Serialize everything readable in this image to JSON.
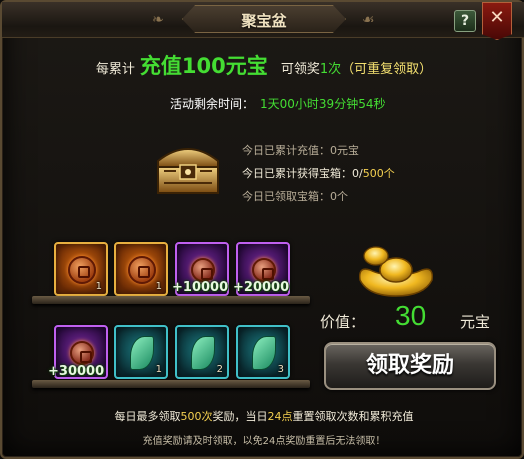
{
  "window": {
    "title": "聚宝盆",
    "help_label": "?",
    "close_label": "✕"
  },
  "headline": {
    "prefix": "每累计",
    "highlight": "充值100元宝",
    "middle": "可领奖",
    "count": "1次",
    "note": "（可重复领取）"
  },
  "timer": {
    "label": "活动剩余时间：",
    "value": "1天00小时39分钟54秒"
  },
  "stats": {
    "recharged_label": "今日已累计充值：",
    "recharged_value": "0元宝",
    "chests_label": "今日已累计获得宝箱：",
    "chests_value": "0/",
    "chests_max": "500个",
    "claimed_label": "今日已领取宝箱：",
    "claimed_value": "0个"
  },
  "rewards": {
    "row1": [
      {
        "type": "gold",
        "icon": "copper-coin-icon",
        "qty": "1"
      },
      {
        "type": "gold",
        "icon": "copper-coin-icon",
        "qty": "1"
      },
      {
        "type": "purple",
        "icon": "copper-coin-icon",
        "qty": ""
      },
      {
        "type": "purple",
        "icon": "copper-coin-icon",
        "qty": ""
      }
    ],
    "row1_amounts": [
      "+10000",
      "+20000"
    ],
    "row2": [
      {
        "type": "purple",
        "icon": "copper-coin-icon",
        "qty": ""
      },
      {
        "type": "teal",
        "icon": "jade-leaf-icon",
        "qty": "1"
      },
      {
        "type": "teal",
        "icon": "jade-leaf-icon",
        "qty": "2"
      },
      {
        "type": "teal",
        "icon": "jade-leaf-icon",
        "qty": "3"
      }
    ],
    "row2_amounts": [
      "+30000"
    ]
  },
  "price": {
    "label": "价值：",
    "value": "30",
    "unit": "元宝"
  },
  "claim_button": "领取奖励",
  "footer": {
    "line1_a": "每日最多领取",
    "line1_b": "500次",
    "line1_c": "奖励，当日",
    "line1_d": "24点",
    "line1_e": "重置领取次数和累积充值",
    "line2": "充值奖励请及时领取，以免24点奖励重置后无法领取！"
  },
  "colors": {
    "accent_green": "#44dd33",
    "highlight_yellow": "#f4d050",
    "frame_gold": "#5a4a32"
  }
}
